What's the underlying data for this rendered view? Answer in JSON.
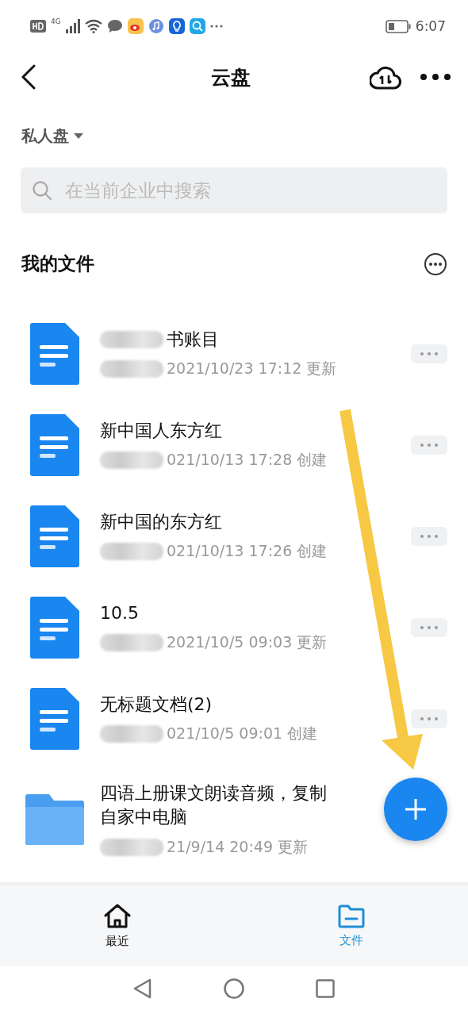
{
  "status_bar": {
    "network": "4G",
    "time": "6:07"
  },
  "header": {
    "title": "云盘"
  },
  "drive_selector": {
    "label": "私人盘"
  },
  "search": {
    "placeholder": "在当前企业中搜索"
  },
  "section": {
    "title": "我的文件"
  },
  "files": [
    {
      "kind": "doc",
      "title": "书账目",
      "title_blurred": true,
      "meta": "2021/10/23 17:12 更新",
      "more_button": true
    },
    {
      "kind": "doc",
      "title": "新中国人东方红",
      "title_blurred": false,
      "meta": "021/10/13 17:28 创建",
      "more_button": true
    },
    {
      "kind": "doc",
      "title": "新中国的东方红",
      "title_blurred": false,
      "meta": "021/10/13 17:26 创建",
      "more_button": true
    },
    {
      "kind": "doc",
      "title": "10.5",
      "title_blurred": false,
      "meta": "2021/10/5 09:03 更新",
      "more_button": true
    },
    {
      "kind": "doc",
      "title": "无标题文档(2)",
      "title_blurred": false,
      "meta": "021/10/5 09:01 创建",
      "more_button": true
    },
    {
      "kind": "folder",
      "title": "四语上册课文朗读音频，复制自家中电脑",
      "title_blurred": false,
      "meta": "21/9/14 20:49 更新",
      "more_button": false
    }
  ],
  "bottom_nav": [
    {
      "kind": "home",
      "label": "最近",
      "selected": false
    },
    {
      "kind": "folder",
      "label": "文件",
      "selected": true
    }
  ]
}
